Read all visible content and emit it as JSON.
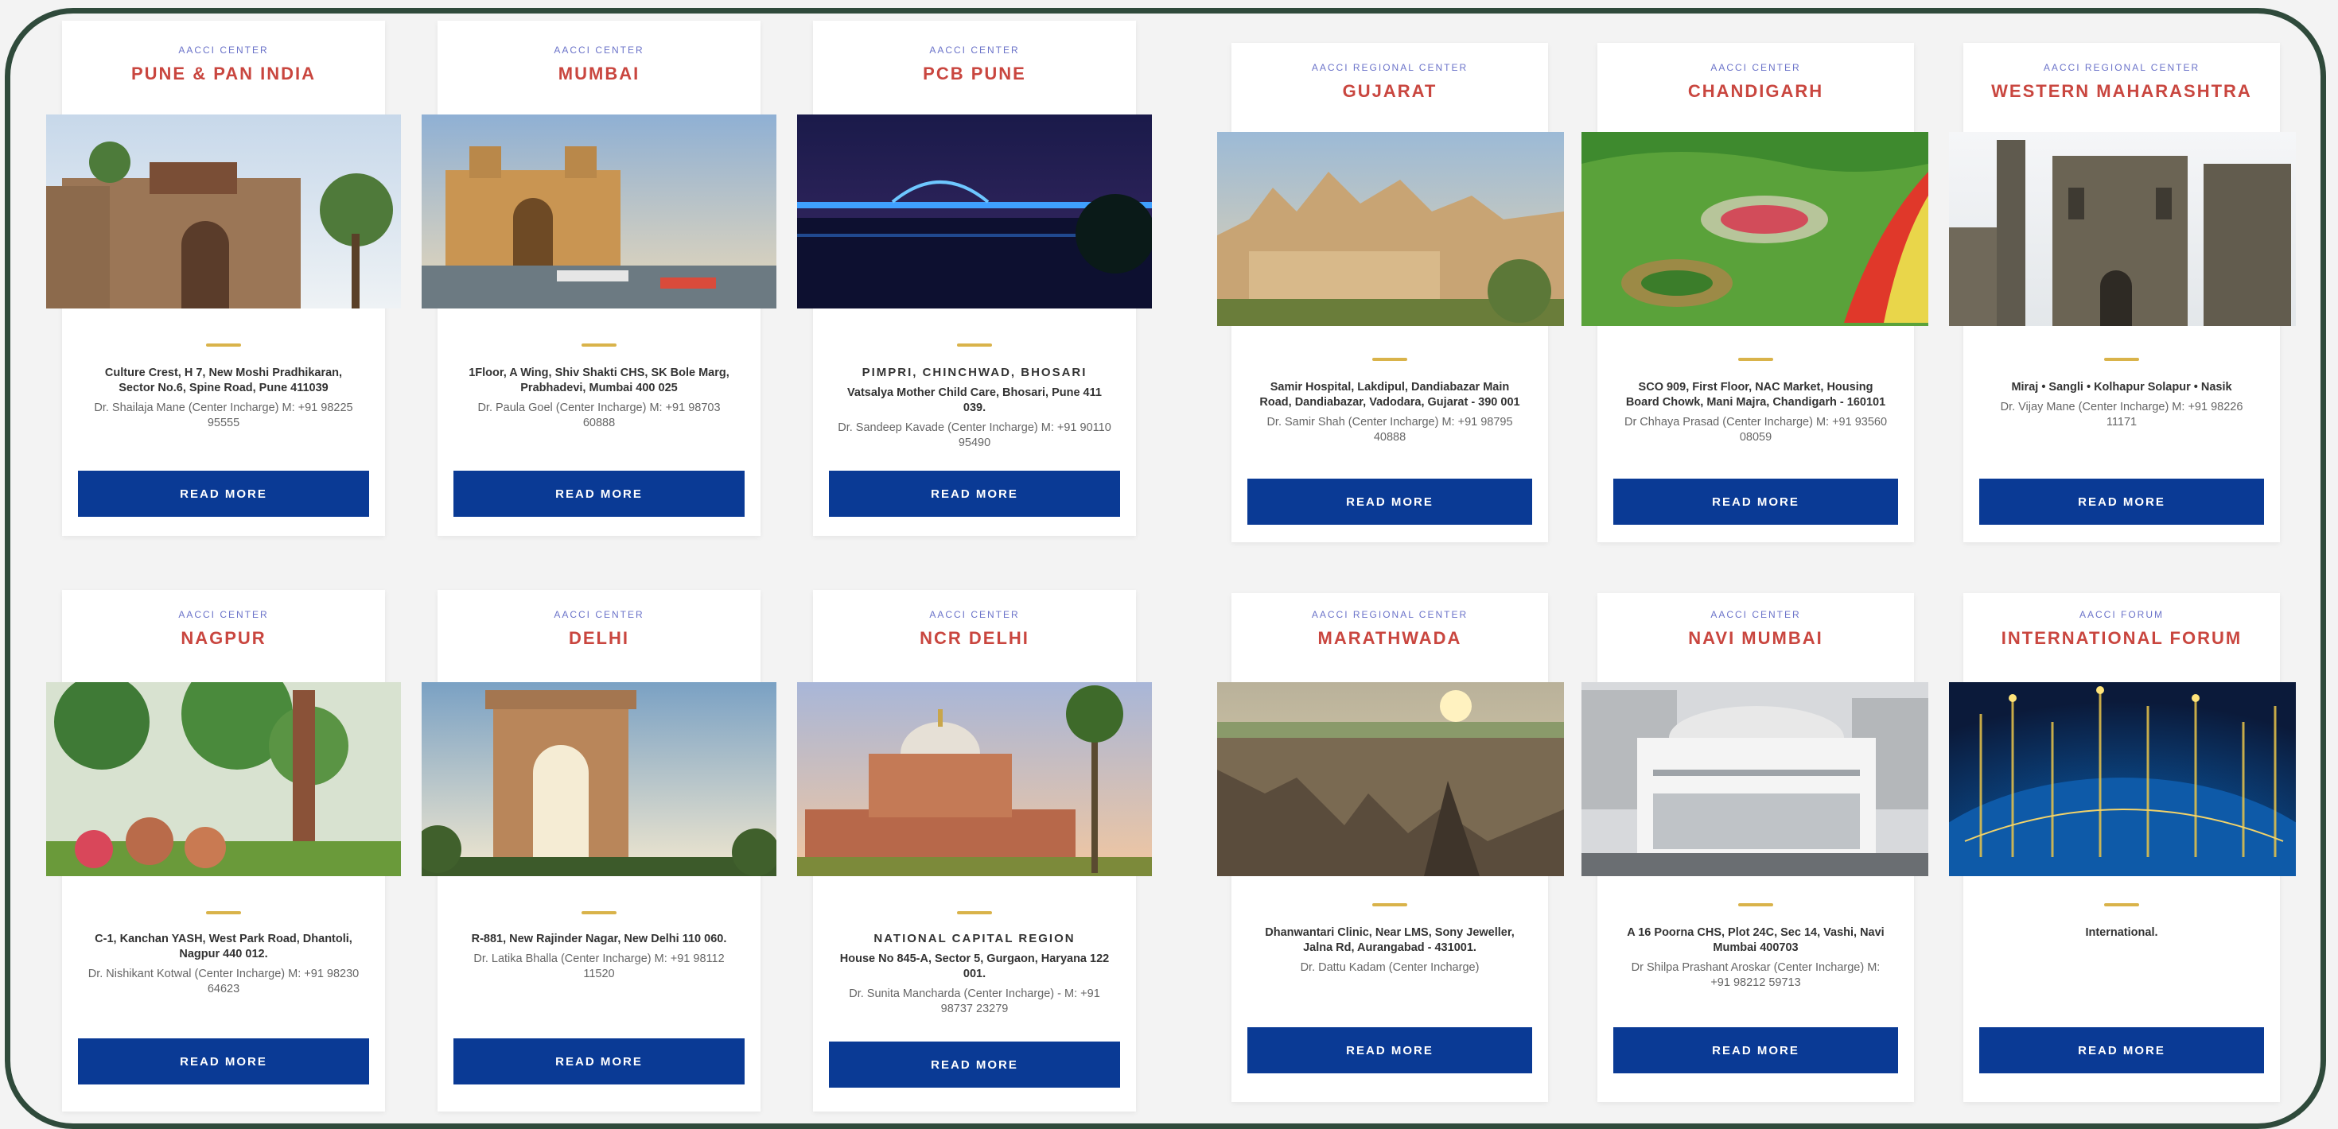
{
  "centers": [
    {
      "subtitle": "AACCI CENTER",
      "name": "PUNE & PAN INDIA",
      "lead": "",
      "address": "Culture Crest, H 7, New Moshi Pradhikaran, Sector No.6, Spine Road, Pune 411039",
      "contact": "Dr. Shailaja Mane (Center Incharge) M: +91 98225 95555",
      "button": "READ MORE",
      "image_alt": "pune-fort-photo"
    },
    {
      "subtitle": "AACCI CENTER",
      "name": "MUMBAI",
      "lead": "",
      "address": "1Floor, A Wing, Shiv Shakti CHS, SK Bole Marg, Prabhadevi, Mumbai 400 025",
      "contact": "Dr. Paula Goel (Center Incharge) M: +91 98703 60888",
      "button": "READ MORE",
      "image_alt": "gateway-of-india-photo"
    },
    {
      "subtitle": "AACCI CENTER",
      "name": "PCB PUNE",
      "lead": "PIMPRI, CHINCHWAD, BHOSARI",
      "address": "Vatsalya Mother Child Care, Bhosari, Pune 411 039.",
      "contact": "Dr. Sandeep Kavade (Center Incharge) M: +91 90110 95490",
      "button": "READ MORE",
      "image_alt": "night-bridge-photo"
    },
    {
      "subtitle": "AACCI REGIONAL CENTER",
      "name": "GUJARAT",
      "lead": "",
      "address": "Samir Hospital, Lakdipul, Dandiabazar Main Road, Dandiabazar, Vadodara, Gujarat - 390 001",
      "contact": "Dr. Samir Shah (Center Incharge) M: +91 98795 40888",
      "button": "READ MORE",
      "image_alt": "gujarat-temple-photo"
    },
    {
      "subtitle": "AACCI CENTER",
      "name": "CHANDIGARH",
      "lead": "",
      "address": "SCO 909, First Floor, NAC Market, Housing Board Chowk, Mani Majra, Chandigarh - 160101",
      "contact": "Dr Chhaya Prasad (Center Incharge) M: +91 93560 08059",
      "button": "READ MORE",
      "image_alt": "rose-garden-photo"
    },
    {
      "subtitle": "AACCI REGIONAL CENTER",
      "name": "WESTERN MAHARASHTRA",
      "lead": "",
      "address": "Miraj • Sangli • Kolhapur Solapur • Nasik",
      "contact": "Dr. Vijay Mane (Center Incharge) M: +91 98226 11171",
      "button": "READ MORE",
      "image_alt": "heritage-building-photo"
    },
    {
      "subtitle": "AACCI CENTER",
      "name": "NAGPUR",
      "lead": "",
      "address": "C-1, Kanchan YASH, West Park Road, Dhantoli, Nagpur 440 012.",
      "contact": "Dr. Nishikant Kotwal (Center Incharge) M: +91 98230 64623",
      "button": "READ MORE",
      "image_alt": "nagpur-garden-photo"
    },
    {
      "subtitle": "AACCI CENTER",
      "name": "DELHI",
      "lead": "",
      "address": "R-881, New Rajinder Nagar, New Delhi 110 060.",
      "contact": "Dr. Latika Bhalla (Center Incharge) M: +91 98112 11520",
      "button": "READ MORE",
      "image_alt": "india-gate-photo"
    },
    {
      "subtitle": "AACCI CENTER",
      "name": "NCR DELHI",
      "lead": "NATIONAL CAPITAL REGION",
      "address": "House No 845-A, Sector 5, Gurgaon, Haryana 122 001.",
      "contact": "Dr. Sunita Mancharda (Center Incharge) - M: +91 98737 23279",
      "button": "READ MORE",
      "image_alt": "humayun-tomb-photo"
    },
    {
      "subtitle": "AACCI REGIONAL CENTER",
      "name": "MARATHWADA",
      "lead": "",
      "address": "Dhanwantari Clinic, Near LMS, Sony Jeweller, Jalna Rd, Aurangabad - 431001.",
      "contact": "Dr. Dattu Kadam (Center Incharge)",
      "button": "READ MORE",
      "image_alt": "canyon-landscape-photo"
    },
    {
      "subtitle": "AACCI CENTER",
      "name": "NAVI MUMBAI",
      "lead": "",
      "address": "A 16 Poorna CHS, Plot 24C, Sec 14, Vashi, Navi Mumbai 400703",
      "contact": "Dr Shilpa Prashant Aroskar (Center Incharge) M: +91 98212 59713",
      "button": "READ MORE",
      "image_alt": "navi-mumbai-building-photo"
    },
    {
      "subtitle": "AACCI FORUM",
      "name": "INTERNATIONAL FORUM",
      "lead": "",
      "address": "International.",
      "contact": "",
      "button": "READ MORE",
      "image_alt": "globe-network-photo"
    }
  ]
}
